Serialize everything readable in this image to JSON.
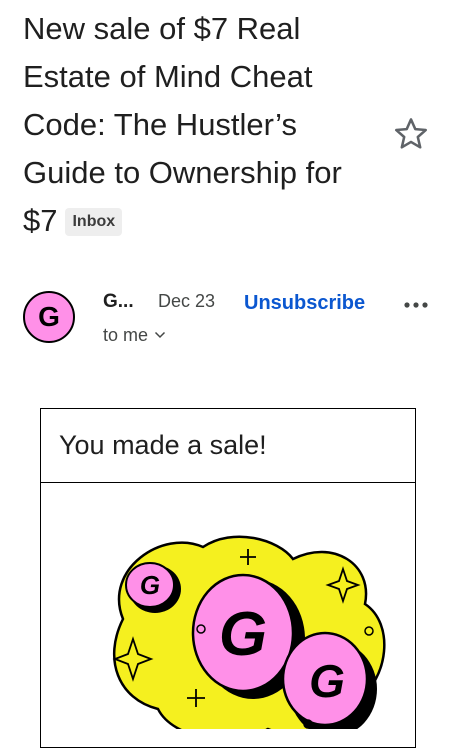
{
  "email": {
    "subject": "New sale of $7 Real Estate of Mind Cheat Code: The Hustler’s Guide to Ownership for $7",
    "label": "Inbox",
    "star_icon": "star-outline-icon"
  },
  "sender": {
    "avatar_letter": "G",
    "name": "G...",
    "date": "Dec 23",
    "unsubscribe_label": "Unsubscribe",
    "recipient": "to me",
    "more_icon": "more-horizontal-icon",
    "chevron_icon": "chevron-down-icon"
  },
  "body": {
    "card_title": "You made a sale!",
    "illustration_letter": "G"
  },
  "colors": {
    "brand_pink": "#ff90e8",
    "brand_yellow": "#f5f01f",
    "link_blue": "#0b57d0"
  }
}
